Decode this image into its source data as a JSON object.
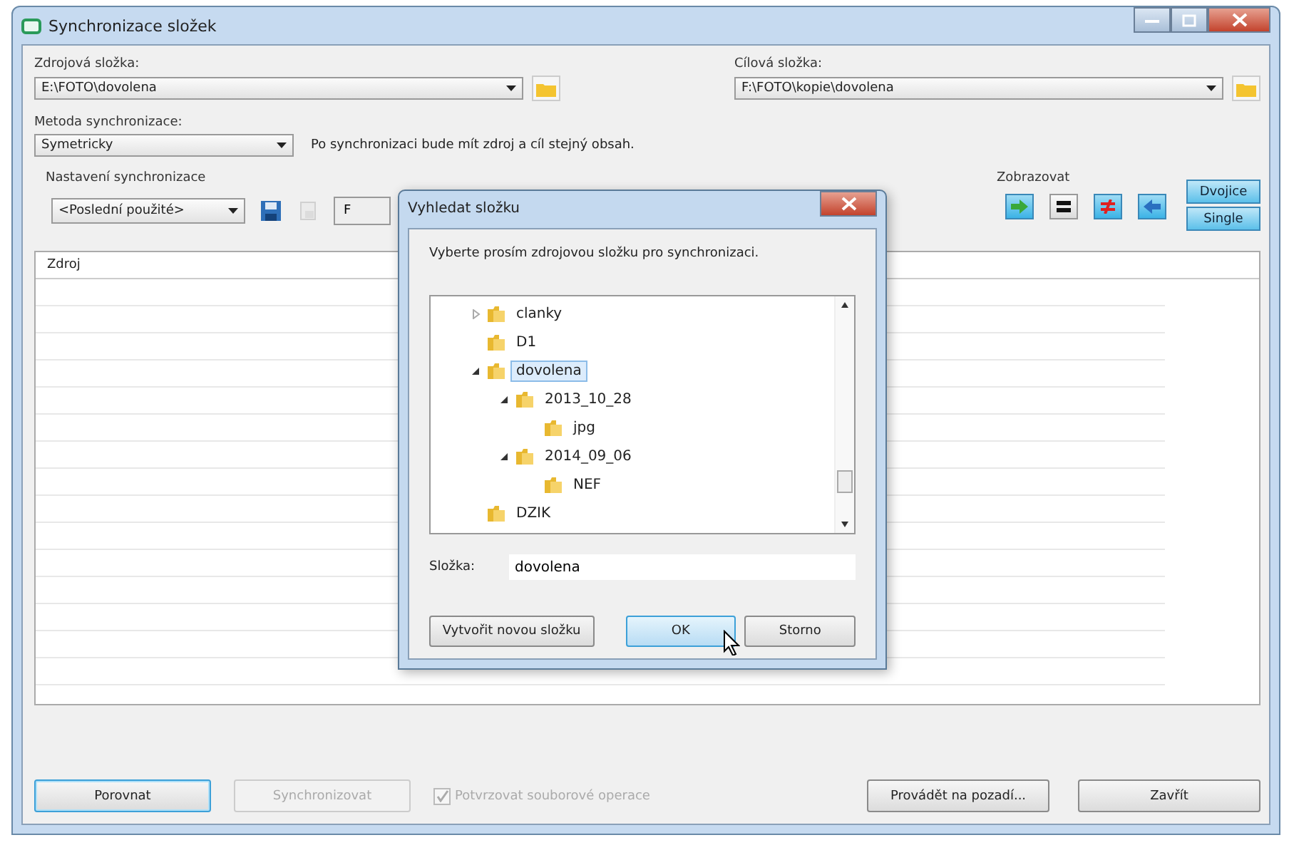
{
  "window": {
    "title": "Synchronizace složek"
  },
  "source": {
    "label": "Zdrojová složka:",
    "value": "E:\\FOTO\\dovolena"
  },
  "target": {
    "label": "Cílová složka:",
    "value": "F:\\FOTO\\kopie\\dovolena"
  },
  "method": {
    "label": "Metoda synchronizace:",
    "value": "Symetricky",
    "description": "Po synchronizaci bude mít zdroj a cíl stejný obsah."
  },
  "settings": {
    "label": "Nastavení synchronizace",
    "value": "<Poslední použité>",
    "hidden_button": "F"
  },
  "view": {
    "label": "Zobrazovat",
    "modes": [
      {
        "label": "Dvojice"
      },
      {
        "label": "Single"
      }
    ]
  },
  "table": {
    "columns": [
      "Zdroj"
    ]
  },
  "footer": {
    "buttons": [
      {
        "label": "Porovnat",
        "disabled": false,
        "focused": true
      },
      {
        "label": "Synchronizovat",
        "disabled": true,
        "focused": false
      }
    ],
    "confirm": {
      "label": "Potvrzovat souborové operace",
      "checked": true,
      "disabled": true
    },
    "right_buttons": [
      "Provádět na pozadí...",
      "Zavřít"
    ]
  },
  "dialog": {
    "title": "Vyhledat složku",
    "prompt": "Vyberte prosím zdrojovou složku pro synchronizaci.",
    "tree": [
      {
        "name": "clanky",
        "expanded": false,
        "selected": false
      },
      {
        "name": "D1",
        "selected": false
      },
      {
        "name": "dovolena",
        "expanded": true,
        "selected": true,
        "children": [
          {
            "name": "2013_10_28",
            "expanded": true,
            "selected": false,
            "children": [
              {
                "name": "jpg",
                "selected": false
              }
            ]
          },
          {
            "name": "2014_09_06",
            "expanded": true,
            "selected": false,
            "children": [
              {
                "name": "NEF",
                "selected": false
              }
            ]
          }
        ]
      },
      {
        "name": "DZIK",
        "selected": false
      }
    ],
    "folder_label": "Složka:",
    "folder_value": "dovolena",
    "buttons": [
      "Vytvořit novou složku",
      "OK",
      "Storno"
    ]
  }
}
